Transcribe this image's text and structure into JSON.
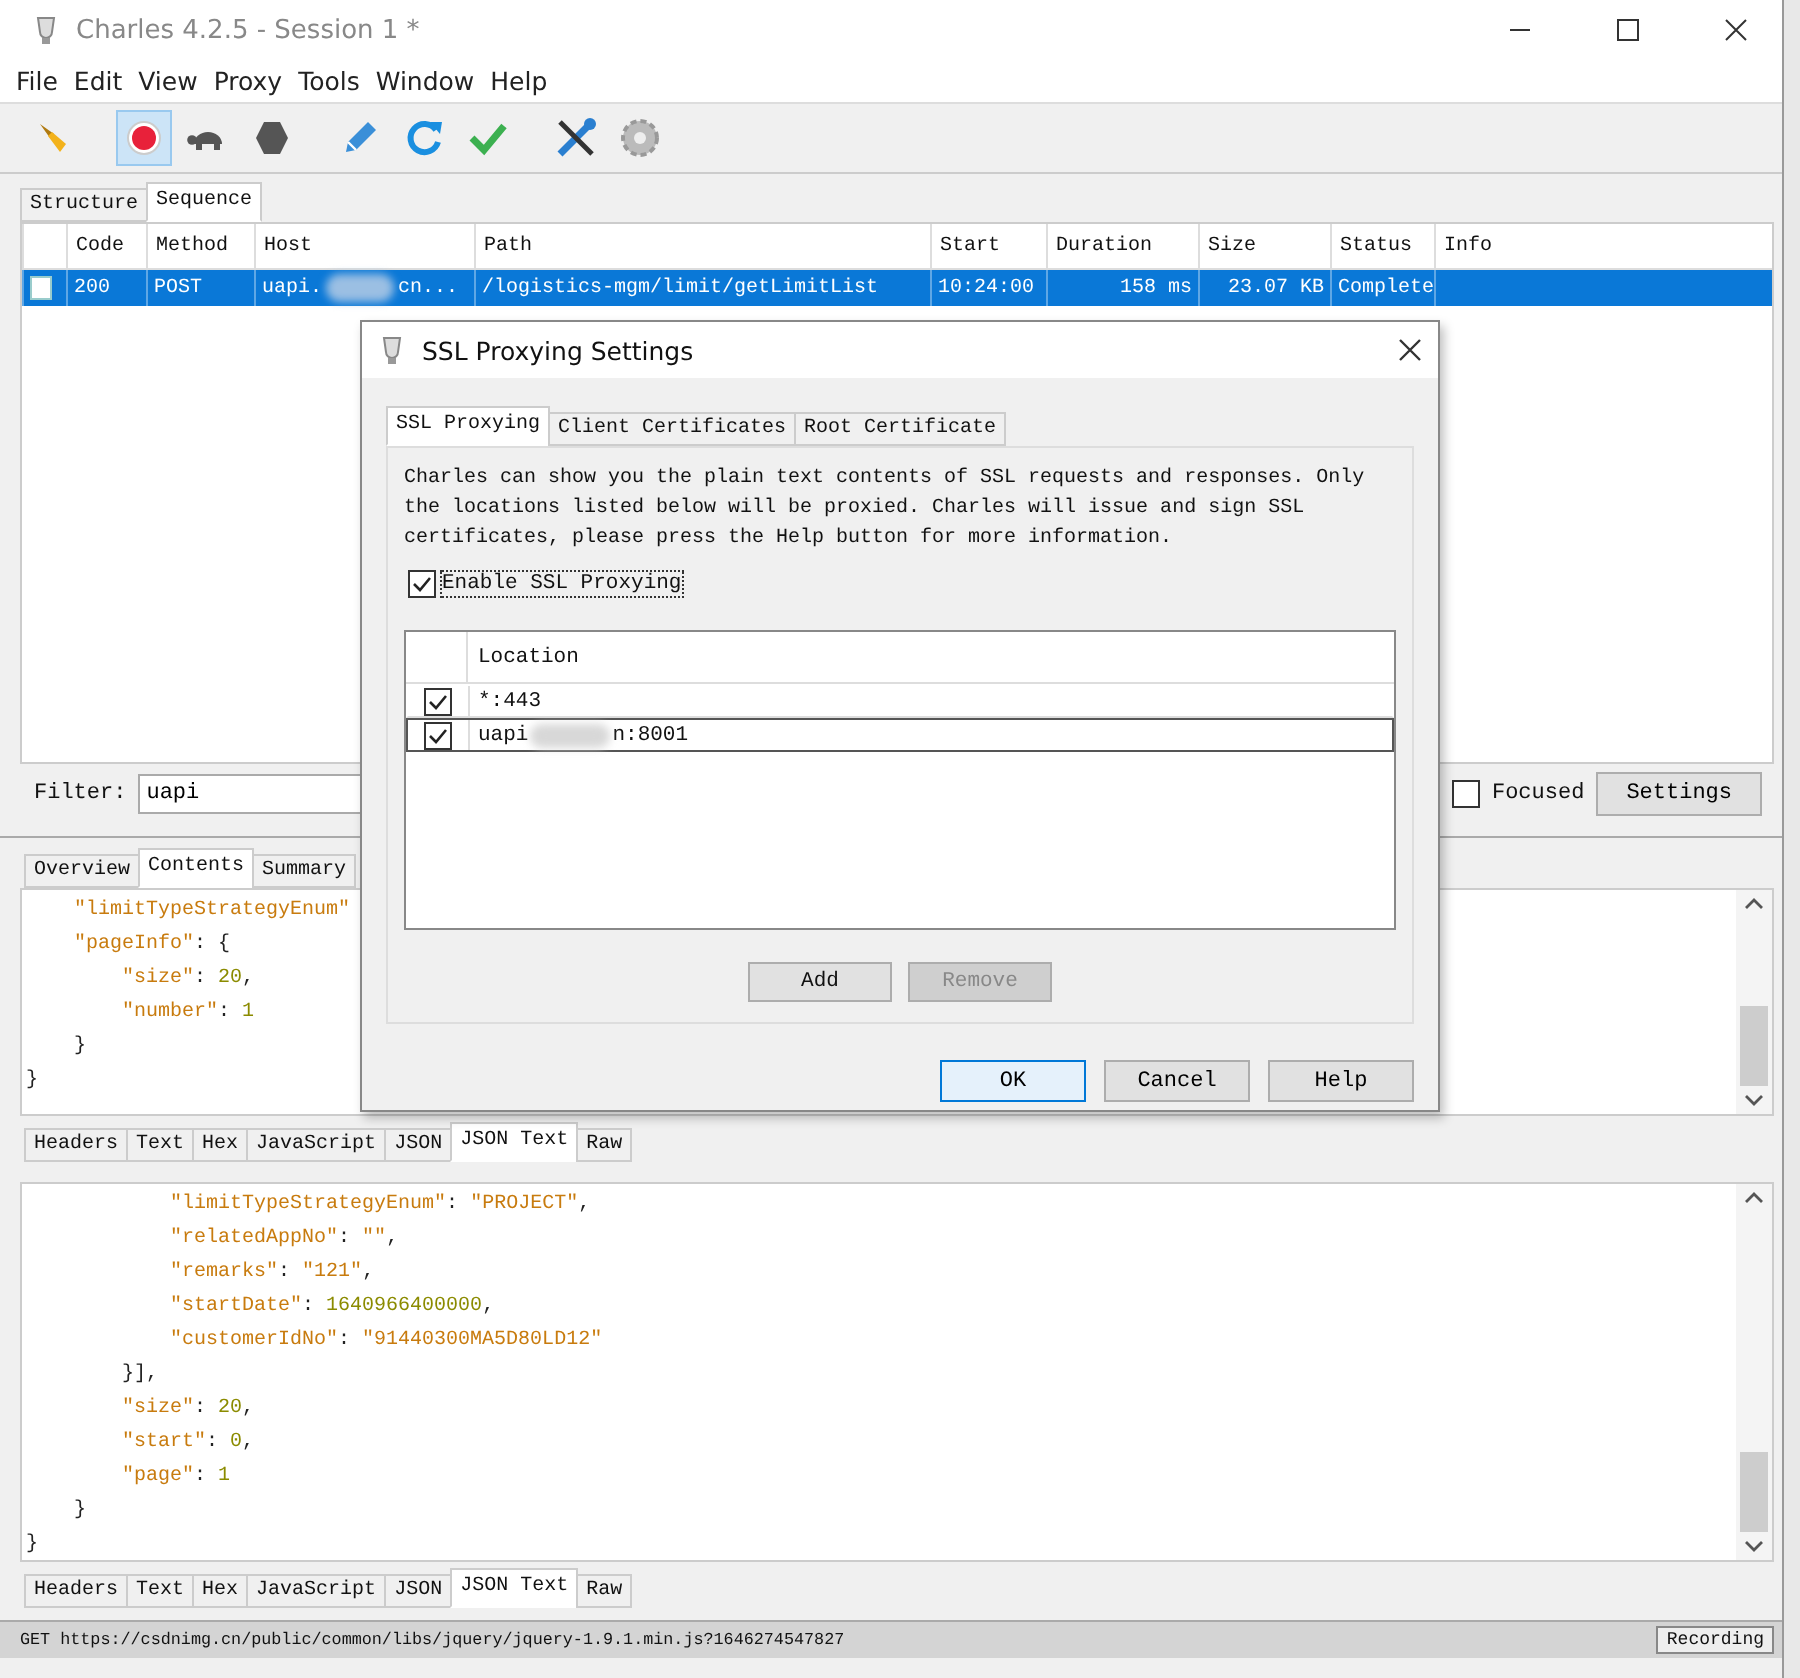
{
  "window": {
    "title": "Charles 4.2.5 - Session 1 *"
  },
  "menu": [
    "File",
    "Edit",
    "View",
    "Proxy",
    "Tools",
    "Window",
    "Help"
  ],
  "toolbar": [
    {
      "kind": "broom",
      "selected": false
    },
    {
      "kind": "record",
      "selected": true
    },
    {
      "kind": "turtle",
      "selected": false
    },
    {
      "kind": "stop",
      "selected": false
    },
    {
      "kind": "pen",
      "selected": false
    },
    {
      "kind": "refresh",
      "selected": false
    },
    {
      "kind": "check",
      "selected": false
    },
    {
      "kind": "tools",
      "selected": false
    },
    {
      "kind": "gear",
      "selected": false
    }
  ],
  "view_tabs": [
    {
      "label": "Structure",
      "selected": false
    },
    {
      "label": "Sequence",
      "selected": true
    }
  ],
  "table": {
    "columns": [
      "Code",
      "Method",
      "Host",
      "Path",
      "Start",
      "Duration",
      "Size",
      "Status",
      "Info"
    ],
    "rows": [
      {
        "selected": true,
        "code": "200",
        "method": "POST",
        "host_start": "uapi.",
        "host_end": "cn...",
        "path": "/logistics-mgm/limit/getLimitList",
        "start": "10:24:00",
        "duration": "158 ms",
        "size": "23.07 KB",
        "status": "Complete"
      }
    ]
  },
  "filter": {
    "label": "Filter:",
    "value": "uapi",
    "focused": {
      "label": "Focused",
      "checked": false
    },
    "settings": "Settings"
  },
  "detail_tabs": [
    {
      "label": "Overview",
      "selected": false
    },
    {
      "label": "Contents",
      "selected": true
    },
    {
      "label": "Summary",
      "selected": false
    }
  ],
  "request_body": {
    "lines": [
      [
        {
          "kind": "key",
          "text": "    \"limitTypeStrategyEnum\""
        }
      ],
      [
        {
          "kind": "key",
          "text": "    \"pageInfo\""
        },
        {
          "kind": "punct",
          "text": ": {"
        }
      ],
      [
        {
          "kind": "key",
          "text": "        \"size\""
        },
        {
          "kind": "punct",
          "text": ": "
        },
        {
          "kind": "number",
          "text": "20"
        },
        {
          "kind": "punct",
          "text": ","
        }
      ],
      [
        {
          "kind": "key",
          "text": "        \"number\""
        },
        {
          "kind": "punct",
          "text": ": "
        },
        {
          "kind": "number",
          "text": "1"
        }
      ],
      [
        {
          "kind": "punct",
          "text": "    }"
        }
      ],
      [
        {
          "kind": "punct",
          "text": "}"
        }
      ]
    ],
    "tabs": [
      {
        "label": "Headers",
        "selected": false
      },
      {
        "label": "Text",
        "selected": false
      },
      {
        "label": "Hex",
        "selected": false
      },
      {
        "label": "JavaScript",
        "selected": false
      },
      {
        "label": "JSON",
        "selected": false
      },
      {
        "label": "JSON Text",
        "selected": true
      },
      {
        "label": "Raw",
        "selected": false
      }
    ]
  },
  "response_body": {
    "lines": [
      [
        {
          "kind": "key",
          "text": "            \"limitTypeStrategyEnum\""
        },
        {
          "kind": "punct",
          "text": ": "
        },
        {
          "kind": "string",
          "text": "\"PROJECT\""
        },
        {
          "kind": "punct",
          "text": ","
        }
      ],
      [
        {
          "kind": "key",
          "text": "            \"relatedAppNo\""
        },
        {
          "kind": "punct",
          "text": ": "
        },
        {
          "kind": "string",
          "text": "\"\""
        },
        {
          "kind": "punct",
          "text": ","
        }
      ],
      [
        {
          "kind": "key",
          "text": "            \"remarks\""
        },
        {
          "kind": "punct",
          "text": ": "
        },
        {
          "kind": "string",
          "text": "\"121\""
        },
        {
          "kind": "punct",
          "text": ","
        }
      ],
      [
        {
          "kind": "key",
          "text": "            \"startDate\""
        },
        {
          "kind": "punct",
          "text": ": "
        },
        {
          "kind": "number",
          "text": "1640966400000"
        },
        {
          "kind": "punct",
          "text": ","
        }
      ],
      [
        {
          "kind": "key",
          "text": "            \"customerIdNo\""
        },
        {
          "kind": "punct",
          "text": ": "
        },
        {
          "kind": "string",
          "text": "\"91440300MA5D80LD12\""
        }
      ],
      [
        {
          "kind": "punct",
          "text": "        }],"
        }
      ],
      [
        {
          "kind": "key",
          "text": "        \"size\""
        },
        {
          "kind": "punct",
          "text": ": "
        },
        {
          "kind": "number",
          "text": "20"
        },
        {
          "kind": "punct",
          "text": ","
        }
      ],
      [
        {
          "kind": "key",
          "text": "        \"start\""
        },
        {
          "kind": "punct",
          "text": ": "
        },
        {
          "kind": "number",
          "text": "0"
        },
        {
          "kind": "punct",
          "text": ","
        }
      ],
      [
        {
          "kind": "key",
          "text": "        \"page\""
        },
        {
          "kind": "punct",
          "text": ": "
        },
        {
          "kind": "number",
          "text": "1"
        }
      ],
      [
        {
          "kind": "punct",
          "text": "    }"
        }
      ],
      [
        {
          "kind": "punct",
          "text": "}"
        }
      ]
    ],
    "tabs": [
      {
        "label": "Headers",
        "selected": false
      },
      {
        "label": "Text",
        "selected": false
      },
      {
        "label": "Hex",
        "selected": false
      },
      {
        "label": "JavaScript",
        "selected": false
      },
      {
        "label": "JSON",
        "selected": false
      },
      {
        "label": "JSON Text",
        "selected": true
      },
      {
        "label": "Raw",
        "selected": false
      }
    ]
  },
  "status_bar": {
    "text": "GET https://csdnimg.cn/public/common/libs/jquery/jquery-1.9.1.min.js?1646274547827",
    "badge": "Recording"
  },
  "dialog": {
    "title": "SSL Proxying Settings",
    "tabs": [
      {
        "label": "SSL Proxying",
        "selected": true
      },
      {
        "label": "Client Certificates",
        "selected": false
      },
      {
        "label": "Root Certificate",
        "selected": false
      }
    ],
    "description": "Charles can show you the plain text contents of SSL requests and responses. Only the locations listed below will be proxied. Charles will issue and sign SSL certificates, please press the Help button for more information.",
    "enable": {
      "label": "Enable SSL Proxying",
      "checked": true
    },
    "location_header": "Location",
    "locations": [
      {
        "checked": true,
        "selected": false,
        "host_start": "*:443"
      },
      {
        "checked": true,
        "selected": true,
        "host_start": "uapi",
        "host_end": "n:8001"
      }
    ],
    "actions": [
      {
        "label": "Add",
        "disabled": false
      },
      {
        "label": "Remove",
        "disabled": true
      }
    ],
    "buttons": [
      {
        "label": "OK",
        "default": true
      },
      {
        "label": "Cancel",
        "default": false
      },
      {
        "label": "Help",
        "default": false
      }
    ]
  }
}
